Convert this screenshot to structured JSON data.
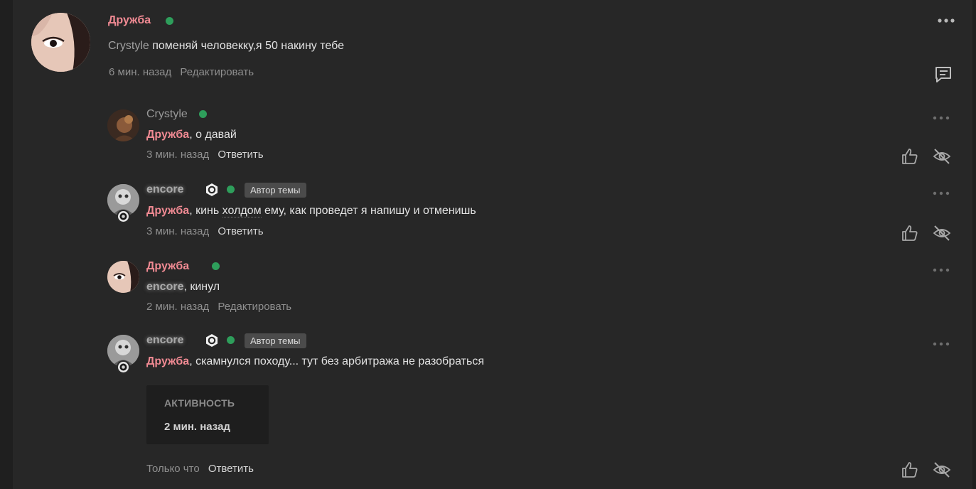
{
  "comments": [
    {
      "author": "Дружба",
      "mention": "Crystyle",
      "text": " поменяй человекку,я 50 накину тебе",
      "time": "6 мин. назад",
      "action": "Редактировать"
    },
    {
      "author": "Crystyle",
      "mention": "Дружба",
      "text": ", о давай",
      "time": "3 мин. назад",
      "action": "Ответить"
    },
    {
      "author": "encore",
      "badge": "Автор темы",
      "mention": "Дружба",
      "text_a": ", кинь ",
      "text_link": "холдом",
      "text_b": " ему, как проведет я напишу и отменишь",
      "time": "3 мин. назад",
      "action": "Ответить"
    },
    {
      "author": "Дружба",
      "mention": "encore",
      "text": ", кинул",
      "time": "2 мин. назад",
      "action": "Редактировать"
    },
    {
      "author": "encore",
      "badge": "Автор темы",
      "mention": "Дружба",
      "text": ", скамнулся походу... тут без арбитража не разобраться",
      "activity_label": "АКТИВНОСТЬ",
      "activity_value": "2 мин. назад",
      "time": "Только что",
      "action": "Ответить"
    }
  ],
  "icons": {
    "more": "more-dots-icon",
    "reply": "comment-reply-icon",
    "like": "thumbs-up-icon",
    "hide": "eye-off-icon",
    "shield": "shield-icon",
    "online": "online-status-icon"
  },
  "colors": {
    "background": "#272727",
    "username_pink": "#f08a93",
    "online_green": "#2e9e5b",
    "badge_bg": "#4b4b4b"
  }
}
